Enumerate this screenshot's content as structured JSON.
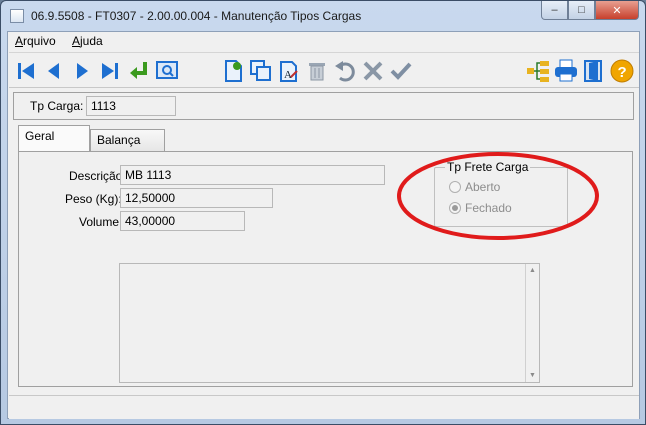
{
  "window": {
    "title": "06.9.5508 - FT0307 - 2.00.00.004 - Manutenção Tipos Cargas",
    "minimize_glyph": "–",
    "maximize_glyph": "□",
    "close_glyph": "✕"
  },
  "menu": {
    "arquivo": {
      "accel": "A",
      "rest": "rquivo"
    },
    "ajuda": {
      "accel": "A",
      "rest": "juda"
    }
  },
  "toolbar": {
    "icons": [
      "first-record-icon",
      "previous-record-icon",
      "next-record-icon",
      "last-record-icon",
      "goto-icon",
      "search-icon",
      "new-record-icon",
      "copy-icon",
      "replace-icon",
      "delete-icon",
      "undo-icon",
      "cancel-icon",
      "save-icon",
      "tree-icon",
      "print-icon",
      "exit-icon",
      "help-icon"
    ]
  },
  "header": {
    "tp_carga_label": "Tp Carga:",
    "tp_carga_value": "1113"
  },
  "tabs": [
    {
      "label": "Geral"
    },
    {
      "label": "Balança"
    }
  ],
  "form": {
    "descricao_label": "Descrição:",
    "descricao_value": "MB 1113",
    "peso_label": "Peso (Kg):",
    "peso_value": "12,50000",
    "volume_label": "Volume:",
    "volume_value": "43,00000"
  },
  "frete_group": {
    "title": "Tp Frete Carga",
    "options": [
      "Aberto",
      "Fechado"
    ],
    "selected": "Fechado"
  },
  "colors": {
    "annotation": "#e01b1b",
    "toolbar_blue": "#1e6fd0",
    "toolbar_green": "#3b9a1e"
  }
}
